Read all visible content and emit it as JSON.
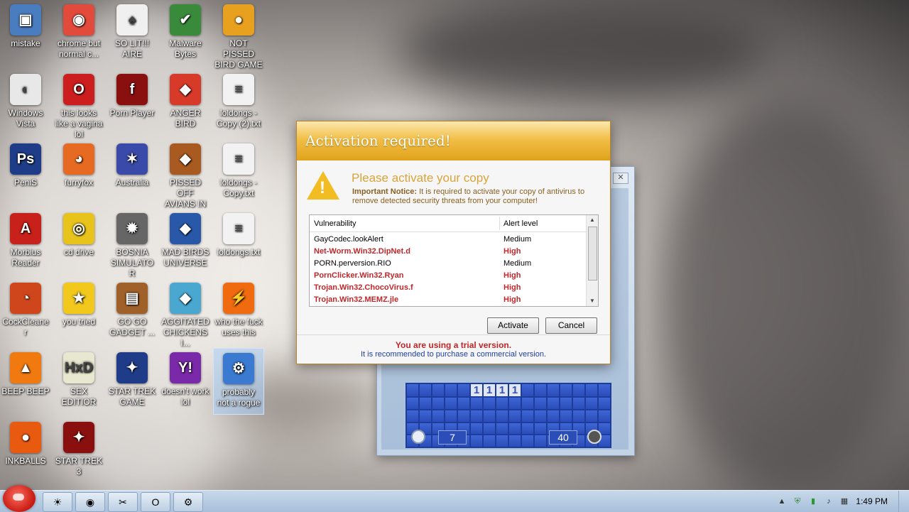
{
  "desktop_icons": [
    {
      "label": "mistake",
      "color": "#4a7cc0",
      "glyph": "▣",
      "icon": "computer-icon"
    },
    {
      "label": "chrome but normal c...",
      "color": "#e24a3b",
      "glyph": "◉",
      "icon": "chrome-icon"
    },
    {
      "label": "SO LIT!!! AIRE",
      "color": "#f0f0f0",
      "glyph": "♠",
      "icon": "cards-icon"
    },
    {
      "label": "Malware Bytes",
      "color": "#3a8a3c",
      "glyph": "✔",
      "icon": "shield-icon"
    },
    {
      "label": "NOT PISSED BIRD GAME",
      "color": "#e8a11f",
      "glyph": "●",
      "icon": "pig-icon"
    },
    {
      "label": "Windows Vista",
      "color": "#e8e8e8",
      "glyph": "◐",
      "icon": "vista-icon"
    },
    {
      "label": "this looks like a vagina lol",
      "color": "#cc1e1e",
      "glyph": "O",
      "icon": "opera-icon"
    },
    {
      "label": "Porn Player",
      "color": "#8a1010",
      "glyph": "f",
      "icon": "flash-icon"
    },
    {
      "label": "ANGER BIRD",
      "color": "#d83a2a",
      "glyph": "◆",
      "icon": "bird-icon"
    },
    {
      "label": "loldongs - Copy (2).txt",
      "color": "#f2f2f2",
      "glyph": "≡",
      "icon": "text-file-icon"
    },
    {
      "label": "PeniS",
      "color": "#1f3c88",
      "glyph": "Ps",
      "icon": "photoshop-icon"
    },
    {
      "label": "furryfox",
      "color": "#e76a22",
      "glyph": "◕",
      "icon": "firefox-icon"
    },
    {
      "label": "Australia",
      "color": "#3a4aa8",
      "glyph": "✶",
      "icon": "spider-icon"
    },
    {
      "label": "PISSED OFF AVIANS IN ...",
      "color": "#a85a20",
      "glyph": "◆",
      "icon": "seasons-bird-icon"
    },
    {
      "label": "loldongs - Copy.txt",
      "color": "#f2f2f2",
      "glyph": "≡",
      "icon": "text-file-icon"
    },
    {
      "label": "Morbius Reader",
      "color": "#c8201a",
      "glyph": "A",
      "icon": "pdf-icon"
    },
    {
      "label": "cd drive",
      "color": "#e8c31c",
      "glyph": "◎",
      "icon": "cd-icon"
    },
    {
      "label": "BOSNIA SIMULATOR",
      "color": "#666666",
      "glyph": "✹",
      "icon": "mine-icon"
    },
    {
      "label": "MAD BIRDS UNIVERSE",
      "color": "#2a58a8",
      "glyph": "◆",
      "icon": "space-bird-icon"
    },
    {
      "label": "loldongs.txt",
      "color": "#f2f2f2",
      "glyph": "≡",
      "icon": "text-file-icon"
    },
    {
      "label": "CockCleaner",
      "color": "#d0461c",
      "glyph": "◔",
      "icon": "ccleaner-icon"
    },
    {
      "label": "you tried",
      "color": "#f2c81c",
      "glyph": "★",
      "icon": "star-icon"
    },
    {
      "label": "GO GO GADGET ...",
      "color": "#a0602a",
      "glyph": "▤",
      "icon": "briefcase-icon"
    },
    {
      "label": "AGGITATED CHICKENS I...",
      "color": "#4aa8d0",
      "glyph": "◆",
      "icon": "rio-bird-icon"
    },
    {
      "label": "who the fuck uses this",
      "color": "#f06a10",
      "glyph": "⚡",
      "icon": "winamp-icon"
    },
    {
      "label": "BEEP BEEP",
      "color": "#f07a10",
      "glyph": "▲",
      "icon": "vlc-icon"
    },
    {
      "label": "SEX EDITIOR",
      "color": "#e8e8d0",
      "glyph": "HxD",
      "icon": "hex-editor-icon"
    },
    {
      "label": "STAR TREK GAME",
      "color": "#1f3c88",
      "glyph": "✦",
      "icon": "star-wars-icon"
    },
    {
      "label": "doesn't work lol",
      "color": "#7a2aa8",
      "glyph": "Y!",
      "icon": "yahoo-icon"
    },
    {
      "label": "probably not a rogue",
      "color": "#3a7ad0",
      "glyph": "⚙",
      "icon": "gears-icon"
    },
    {
      "label": "INKBALLS",
      "color": "#e85a10",
      "glyph": "●",
      "icon": "inkball-icon"
    },
    {
      "label": "STAR TREK 3",
      "color": "#8a1010",
      "glyph": "✦",
      "icon": "star-wars-icon"
    }
  ],
  "minesweeper": {
    "close": "✕",
    "open_cells": [
      "1",
      "1",
      "1",
      "1"
    ],
    "time": "7",
    "mines": "40"
  },
  "dialog": {
    "title": "Activation required!",
    "heading": "Please activate your copy",
    "notice_bold": "Important Notice:",
    "notice_text": " It is required to activate your copy of antivirus to remove detected security threats from your computer!",
    "columns": [
      "Vulnerability",
      "Alert level"
    ],
    "rows": [
      {
        "name": "GayCodec.lookAlert",
        "level": "Medium",
        "severity": "medium"
      },
      {
        "name": "Net-Worm.Win32.DipNet.d",
        "level": "High",
        "severity": "high"
      },
      {
        "name": "PORN.perversion.RIO",
        "level": "Medium",
        "severity": "medium"
      },
      {
        "name": "PornClicker.Win32.Ryan",
        "level": "High",
        "severity": "high"
      },
      {
        "name": "Trojan.Win32.ChocoVirus.f",
        "level": "High",
        "severity": "high"
      },
      {
        "name": "Trojan.Win32.MEMZ.jle",
        "level": "High",
        "severity": "high"
      }
    ],
    "activate_label": "Activate",
    "cancel_label": "Cancel",
    "trial_line": "You are using a trial version.",
    "recommend_line": "It is recommended to purchase a commercial version."
  },
  "taskbar": {
    "buttons": [
      {
        "icon": "explorer-icon",
        "glyph": "☀"
      },
      {
        "icon": "chrome-icon",
        "glyph": "◉"
      },
      {
        "icon": "media-icon",
        "glyph": "✂"
      },
      {
        "icon": "opera-icon",
        "glyph": "O"
      },
      {
        "icon": "gears-icon",
        "glyph": "⚙"
      }
    ],
    "clock": "1:49 PM"
  }
}
